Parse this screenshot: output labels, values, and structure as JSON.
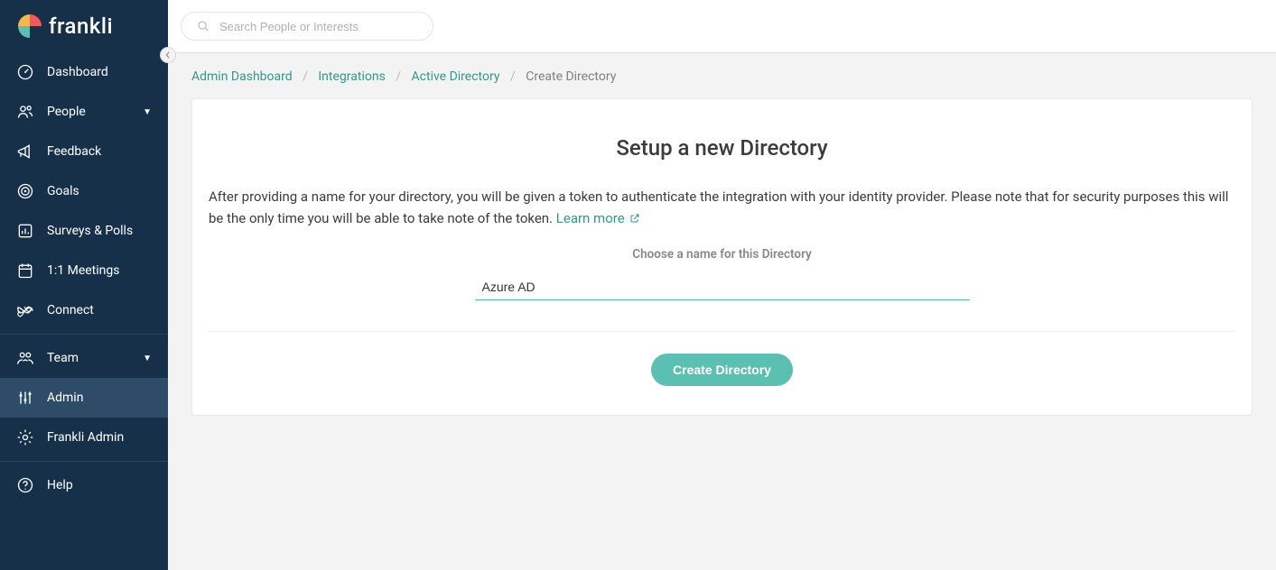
{
  "brand": {
    "name": "frankli"
  },
  "sidebar": {
    "items": [
      {
        "label": "Dashboard"
      },
      {
        "label": "People"
      },
      {
        "label": "Feedback"
      },
      {
        "label": "Goals"
      },
      {
        "label": "Surveys & Polls"
      },
      {
        "label": "1:1 Meetings"
      },
      {
        "label": "Connect"
      },
      {
        "label": "Team"
      },
      {
        "label": "Admin"
      },
      {
        "label": "Frankli Admin"
      },
      {
        "label": "Help"
      }
    ]
  },
  "search": {
    "placeholder": "Search People or Interests"
  },
  "breadcrumb": {
    "items": [
      "Admin Dashboard",
      "Integrations",
      "Active Directory",
      "Create Directory"
    ]
  },
  "card": {
    "title": "Setup a new Directory",
    "description": "After providing a name for your directory, you will be given a token to authenticate the integration with your identity provider. Please note that for security purposes this will be the only time you will be able to take note of the token. ",
    "learn_more": "Learn more",
    "field_label": "Choose a name for this Directory",
    "name_value": "Azure AD",
    "button": "Create Directory"
  }
}
